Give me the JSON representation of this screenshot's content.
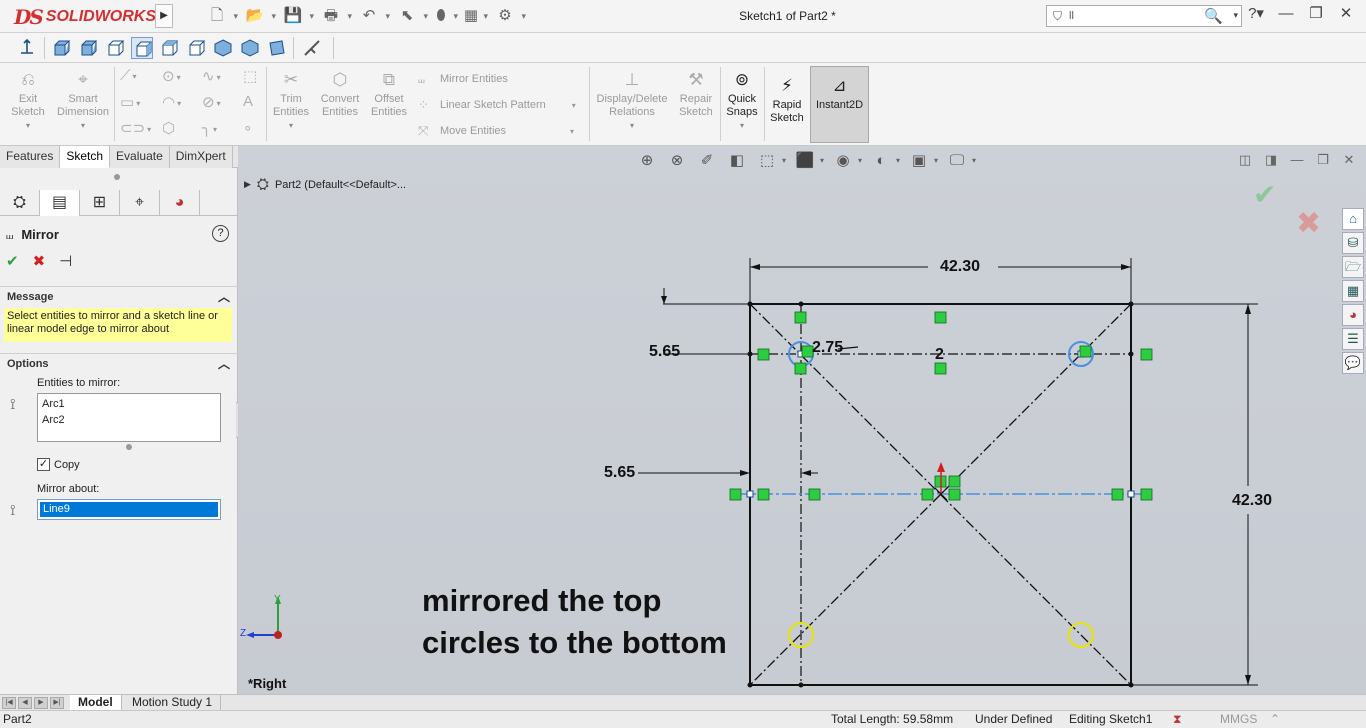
{
  "app": {
    "logo_prefix": "DS",
    "logo_text": "SOLIDWORKS",
    "document_title": "Sketch1 of Part2 *"
  },
  "search": {
    "value": "ll"
  },
  "command_manager": {
    "exit_sketch": "Exit\nSketch",
    "smart_dimension": "Smart\nDimension",
    "trim_entities": "Trim\nEntities",
    "convert_entities": "Convert\nEntities",
    "offset_entities": "Offset\nEntities",
    "mirror_entities": "Mirror Entities",
    "linear_sketch_pattern": "Linear Sketch Pattern",
    "move_entities": "Move Entities",
    "display_delete_relations": "Display/Delete\nRelations",
    "repair_sketch": "Repair\nSketch",
    "quick_snaps": "Quick\nSnaps",
    "rapid_sketch": "Rapid\nSketch",
    "instant2d": "Instant2D"
  },
  "tabs": [
    "Features",
    "Sketch",
    "Evaluate",
    "DimXpert"
  ],
  "property_manager": {
    "title": "Mirror",
    "help": "?",
    "message_header": "Message",
    "message": "Select entities to mirror and a sketch line or linear model edge to mirror about",
    "options_header": "Options",
    "entities_label": "Entities to mirror:",
    "entities": [
      "Arc1",
      "Arc2"
    ],
    "copy_label": "Copy",
    "copy_checked": true,
    "mirror_about_label": "Mirror about:",
    "mirror_about_value": "Line9"
  },
  "graphics": {
    "tree_node": "Part2  (Default<<Default>...",
    "view_label": "*Right",
    "note_line1": "mirrored the top",
    "note_line2": "circles to the bottom",
    "dims": {
      "top_width": "42.30",
      "right_height": "42.30",
      "left_upper": "5.65",
      "left_lower": "5.65",
      "small_dim": "2.75",
      "center_label": "2"
    },
    "triad": {
      "y": "Y",
      "z": "Z"
    }
  },
  "bottom_tabs": [
    "Model",
    "Motion Study 1"
  ],
  "status": {
    "part": "Part2",
    "total_length": "Total Length: 59.58mm",
    "state": "Under Defined",
    "editing": "Editing Sketch1",
    "units": "MMGS"
  }
}
